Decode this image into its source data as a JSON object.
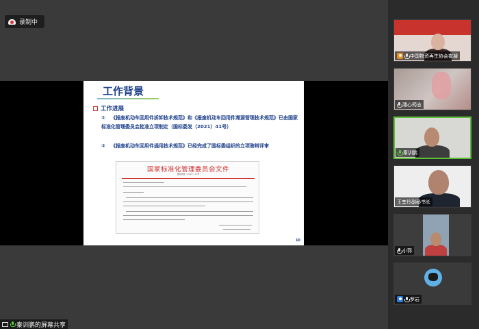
{
  "recording": {
    "label": "录制中"
  },
  "slide": {
    "title": "工作背景",
    "section": "工作进展",
    "items": [
      {
        "num": "①",
        "text": "《报废机动车回用件拆卸技术规范》和《报废机动车回用件溯源管理技术规范》已由国家标准化管理委员会批准立项制定（国标委发（2021）41号）"
      },
      {
        "num": "②",
        "text": "《报废机动车回用件通用技术规范》已经完成了国标委组织的立项答辩评审"
      }
    ],
    "document": {
      "header": "国家标准化管理委员会文件",
      "number": "国标委发〔2021〕41号"
    },
    "page_number": "10"
  },
  "participants": [
    {
      "name": "中国物资再生协会崔凝",
      "role": "host",
      "mic": "muted"
    },
    {
      "name": "潘心筠志",
      "role": "none",
      "mic": "muted"
    },
    {
      "name": "秦训鹏",
      "role": "none",
      "mic": "active"
    },
    {
      "name": "王奎玲副秘书长",
      "role": "none",
      "mic": "none"
    },
    {
      "name": "小郭",
      "role": "none",
      "mic": "muted"
    },
    {
      "name": "罗岩",
      "role": "cohost",
      "mic": "muted"
    }
  ],
  "share_status": {
    "label": "秦训鹏的屏幕共享"
  },
  "colors": {
    "active_speaker": "#5bbf3a",
    "title_blue": "#1d3f8a",
    "doc_red": "#d22a2a"
  }
}
